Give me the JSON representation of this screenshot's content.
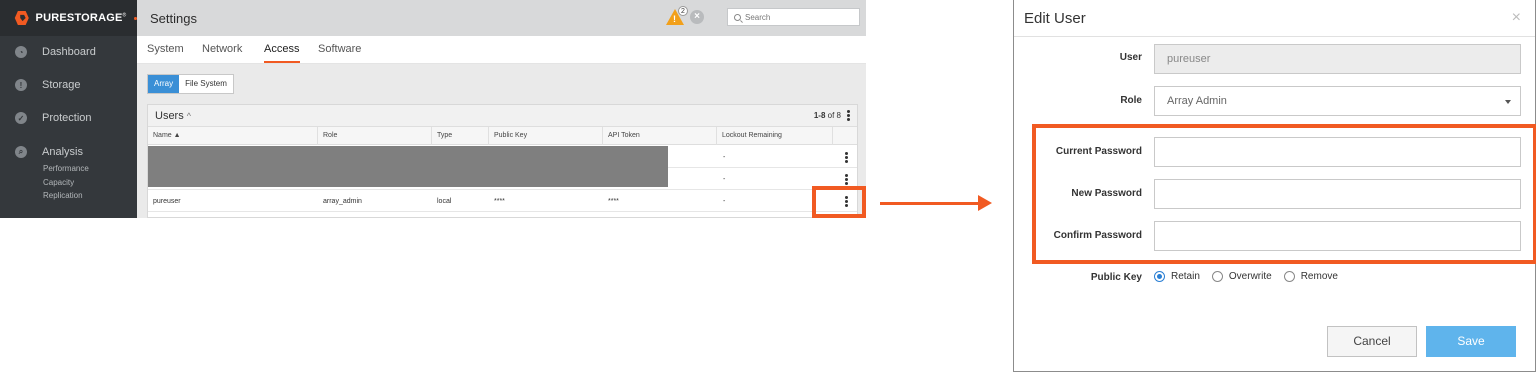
{
  "app": {
    "brand": "PURESTORAGE",
    "brand_tm": "®",
    "page_title": "Settings",
    "alert_count": "2",
    "search_placeholder": "Search",
    "nav": [
      {
        "label": "Dashboard",
        "icon": "dashboard-icon"
      },
      {
        "label": "Storage",
        "icon": "storage-icon"
      },
      {
        "label": "Protection",
        "icon": "shield-icon"
      },
      {
        "label": "Analysis",
        "icon": "analysis-icon"
      }
    ],
    "analysis_sub": [
      "Performance",
      "Capacity",
      "Replication"
    ],
    "tabs": [
      "System",
      "Network",
      "Access",
      "Software"
    ],
    "active_tab": "Access",
    "segments": [
      "Array",
      "File System"
    ],
    "users_panel": {
      "title": "Users",
      "count_range": "1-8",
      "count_of": " of 8",
      "columns": [
        "Name ▲",
        "Role",
        "Type",
        "Public Key",
        "API Token",
        "Lockout Remaining"
      ],
      "rows": [
        {
          "name": "",
          "role": "",
          "type": "",
          "public_key": "",
          "api_token": "",
          "lockout": "-"
        },
        {
          "name": "",
          "role": "",
          "type": "",
          "public_key": "",
          "api_token": "",
          "lockout": "-"
        },
        {
          "name": "pureuser",
          "role": "array_admin",
          "type": "local",
          "public_key": "****",
          "api_token": "****",
          "lockout": "-"
        }
      ]
    },
    "accent_color": "#f15a22",
    "primary_color": "#3a8fd6"
  },
  "dialog": {
    "title": "Edit User",
    "close_glyph": "×",
    "user_label": "User",
    "user_value": "pureuser",
    "role_label": "Role",
    "role_value": "Array Admin",
    "current_password_label": "Current Password",
    "new_password_label": "New Password",
    "confirm_password_label": "Confirm Password",
    "public_key_label": "Public Key",
    "public_key_options": [
      "Retain",
      "Overwrite",
      "Remove"
    ],
    "public_key_selected": "Retain",
    "cancel_label": "Cancel",
    "save_label": "Save",
    "save_color": "#5fb4ec"
  }
}
